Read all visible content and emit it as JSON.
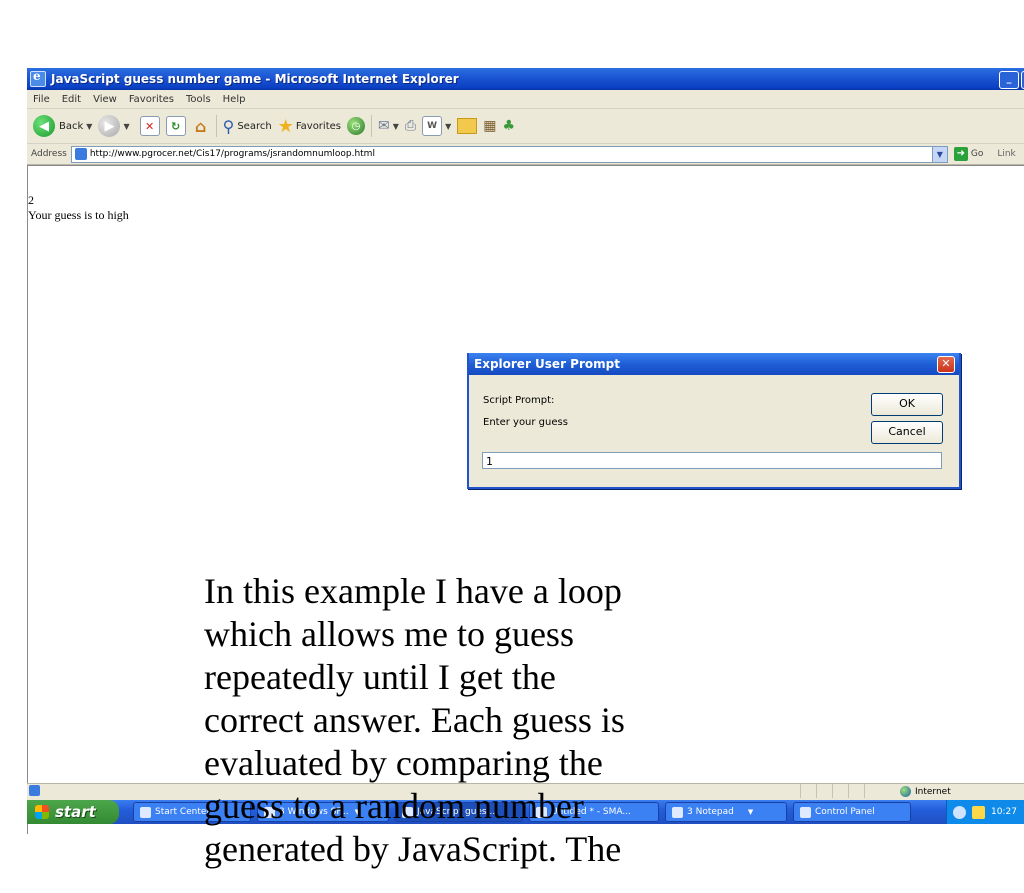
{
  "window": {
    "title": "JavaScript guess number game - Microsoft Internet Explorer",
    "buttons": [
      "_",
      "🗗"
    ]
  },
  "menu": [
    "File",
    "Edit",
    "View",
    "Favorites",
    "Tools",
    "Help"
  ],
  "toolbar": {
    "back_label": "Back",
    "search_label": "Search",
    "favorites_label": "Favorites"
  },
  "address": {
    "label": "Address",
    "url": "http://www.pgrocer.net/Cis17/programs/jsrandomnumloop.html",
    "go_label": "Go",
    "links_label": "Link"
  },
  "page": {
    "line1": "2",
    "line2": "Your guess is to high"
  },
  "dialog": {
    "title": "Explorer User Prompt",
    "close_glyph": "✕",
    "script_prompt_label": "Script Prompt:",
    "prompt_text": "Enter your guess",
    "ok_label": "OK",
    "cancel_label": "Cancel",
    "input_value": "1"
  },
  "status": {
    "zone": "Internet"
  },
  "taskbar": {
    "start_label": "start",
    "tasks": [
      "Start Center",
      "3 Windows SF...",
      "JavaScript gues...",
      "Untitled * - SMA...",
      "3 Notepad",
      "Control Panel"
    ],
    "clock": "10:27"
  },
  "caption": {
    "lines": [
      "In this example I have a loop",
      "which allows me to guess",
      "repeatedly until I get the",
      "correct answer.  Each guess is",
      "evaluated by comparing the",
      "guess to a random number",
      "generated by JavaScript.  The"
    ]
  }
}
